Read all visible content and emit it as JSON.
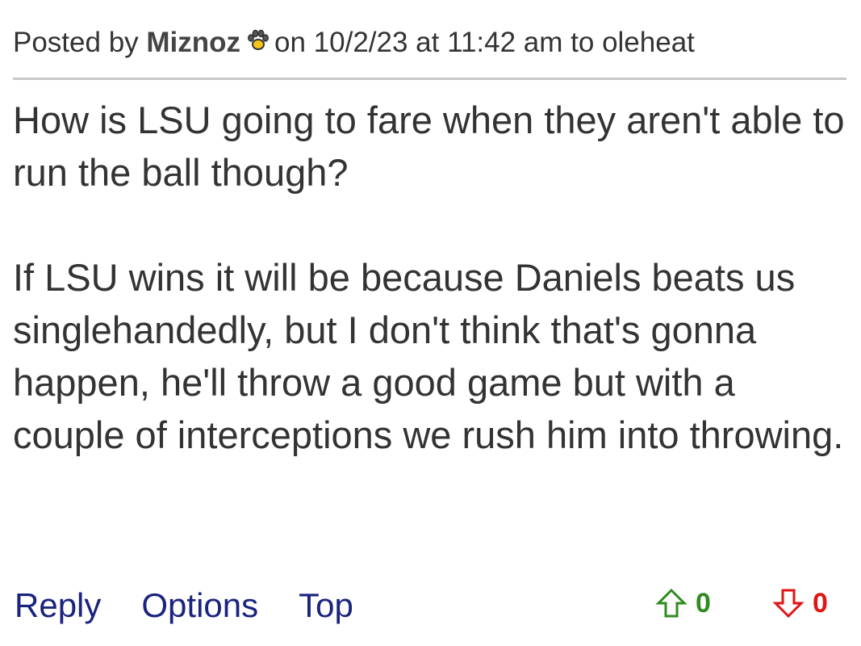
{
  "post": {
    "posted_by_prefix": "Posted by",
    "author": "Miznoz",
    "author_badge_icon": "paw-print-icon",
    "posted_suffix": "on 10/2/23 at 11:42 am to oleheat",
    "paragraphs": [
      "How is LSU going to fare when they aren't able to run the ball though?",
      "If LSU wins it will be because Daniels beats us singlehandedly, but I don't think that's gonna happen, he'll throw a good game but with a couple of interceptions we rush him into throwing."
    ]
  },
  "actions": {
    "reply_label": "Reply",
    "options_label": "Options",
    "top_label": "Top"
  },
  "votes": {
    "upvote_icon": "arrow-up-outline-icon",
    "upvote_count": "0",
    "upvote_color": "#2e8b1e",
    "downvote_icon": "arrow-down-outline-icon",
    "downvote_count": "0",
    "downvote_color": "#e01515"
  },
  "colors": {
    "text": "#333333",
    "link": "#1a237e",
    "divider": "#c8c8c8"
  }
}
